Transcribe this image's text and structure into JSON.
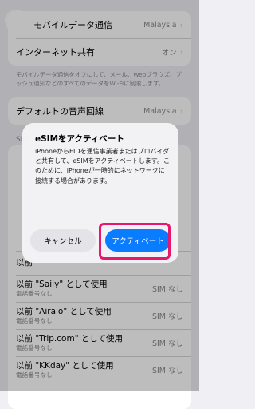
{
  "mobile_data_row": {
    "label": "モバイルデータ通信",
    "value": "Malaysia"
  },
  "hotspot_row": {
    "label": "インターネット共有",
    "value": "オン"
  },
  "footnote": "モバイルデータ通信をオフにして、メール、Webブラウズ、プッシュ通知などのすべてのデータをWi-Fiに制限します。",
  "voice_row": {
    "label": "デフォルトの音声回線",
    "value": "Malaysia"
  },
  "sim_section_title": "SIM",
  "sim_list": [
    {
      "name": "以前 \"Saily\" として使用",
      "sub": "電話番号なし",
      "status": "SIM なし"
    },
    {
      "name": "以前 \"Airalo\" として使用",
      "sub": "電話番号なし",
      "status": "SIM なし"
    },
    {
      "name": "以前 \"Trip.com\" として使用",
      "sub": "電話番号なし",
      "status": "SIM なし"
    },
    {
      "name": "以前 \"KKday\" として使用",
      "sub": "電話番号なし",
      "status": "SIM なし"
    }
  ],
  "partial_row_label": "以前",
  "dialog": {
    "title": "eSIMをアクティベート",
    "message": "iPhoneからEIDを通信事業者またはプロバイダと共有して、eSIMをアクティベートします。このために、iPhoneが一時的にネットワークに接続する場合があります。",
    "cancel_label": "キャンセル",
    "activate_label": "アクティベート"
  },
  "colors": {
    "accent": "#0a7cff",
    "highlight": "#e8176e",
    "background": "#efeff4"
  }
}
